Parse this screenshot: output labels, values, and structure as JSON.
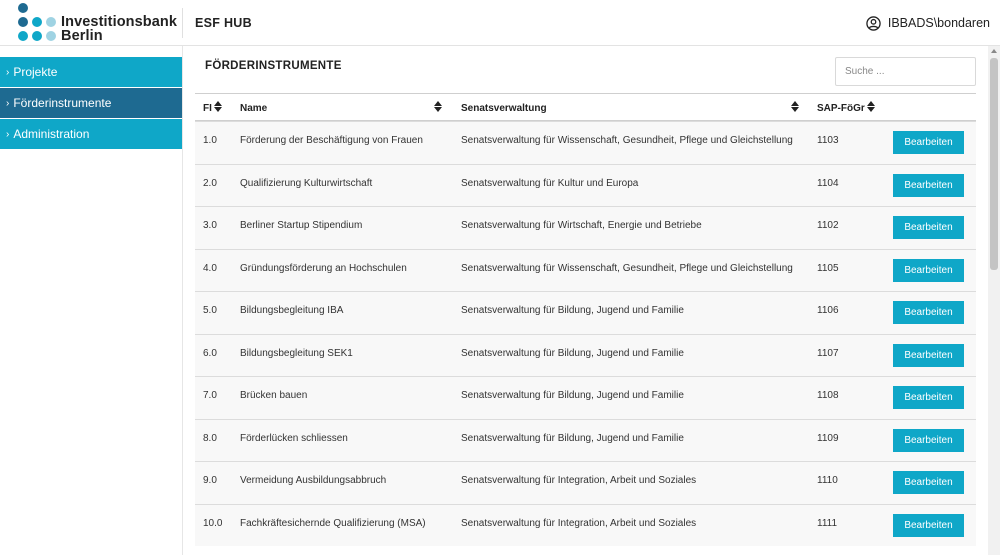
{
  "header": {
    "logo_line1": "Investitionsbank",
    "logo_line2": "Berlin",
    "app_title": "ESF HUB",
    "user_name": "IBBADS\\bondaren"
  },
  "colors": {
    "accent": "#0fa7c8",
    "active_nav": "#1e6a91",
    "logo_dark": "#1e6a91",
    "logo_mid": "#0fa7c8",
    "logo_light": "#9fd3e3"
  },
  "sidebar": {
    "items": [
      {
        "label": "Projekte",
        "active": false
      },
      {
        "label": "Förderinstrumente",
        "active": true
      },
      {
        "label": "Administration",
        "active": false
      }
    ]
  },
  "main": {
    "title": "FÖRDERINSTRUMENTE",
    "search_placeholder": "Suche ...",
    "columns": {
      "fi": "FI",
      "name": "Name",
      "senat": "Senatsverwaltung",
      "sap": "SAP-FöGr"
    },
    "edit_label": "Bearbeiten",
    "rows": [
      {
        "fi": "1.0",
        "name": "Förderung der Beschäftigung von Frauen",
        "senat": "Senatsverwaltung für Wissenschaft, Gesundheit, Pflege und Gleichstellung",
        "sap": "1103"
      },
      {
        "fi": "2.0",
        "name": "Qualifizierung Kulturwirtschaft",
        "senat": "Senatsverwaltung für Kultur und Europa",
        "sap": "1104"
      },
      {
        "fi": "3.0",
        "name": "Berliner Startup Stipendium",
        "senat": "Senatsverwaltung für Wirtschaft, Energie und Betriebe",
        "sap": "1102"
      },
      {
        "fi": "4.0",
        "name": "Gründungsförderung an Hochschulen",
        "senat": "Senatsverwaltung für Wissenschaft, Gesundheit, Pflege und Gleichstellung",
        "sap": "1105"
      },
      {
        "fi": "5.0",
        "name": "Bildungsbegleitung IBA",
        "senat": "Senatsverwaltung für Bildung, Jugend und Familie",
        "sap": "1106"
      },
      {
        "fi": "6.0",
        "name": "Bildungsbegleitung SEK1",
        "senat": "Senatsverwaltung für Bildung, Jugend und Familie",
        "sap": "1107"
      },
      {
        "fi": "7.0",
        "name": "Brücken bauen",
        "senat": "Senatsverwaltung für Bildung, Jugend und Familie",
        "sap": "1108"
      },
      {
        "fi": "8.0",
        "name": "Förderlücken schliessen",
        "senat": "Senatsverwaltung für Bildung, Jugend und Familie",
        "sap": "1109"
      },
      {
        "fi": "9.0",
        "name": "Vermeidung Ausbildungsabbruch",
        "senat": "Senatsverwaltung für Integration, Arbeit und Soziales",
        "sap": "1110"
      },
      {
        "fi": "10.0",
        "name": "Fachkräftesichernde Qualifizierung (MSA)",
        "senat": "Senatsverwaltung für Integration, Arbeit und Soziales",
        "sap": "1111"
      }
    ]
  }
}
